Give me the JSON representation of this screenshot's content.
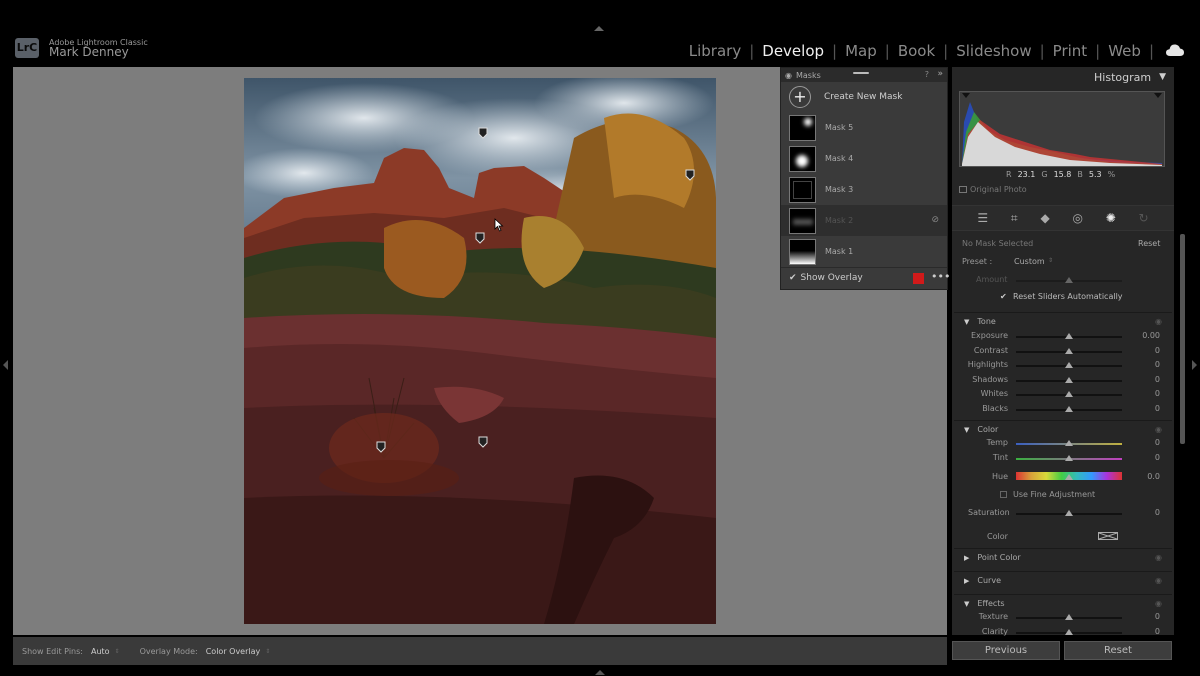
{
  "app": {
    "logo": "LrC",
    "product": "Adobe Lightroom Classic",
    "user": "Mark Denney"
  },
  "modules": [
    "Library",
    "Develop",
    "Map",
    "Book",
    "Slideshow",
    "Print",
    "Web"
  ],
  "active_module": "Develop",
  "masks_panel": {
    "title": "Masks",
    "create_label": "Create New Mask",
    "items": [
      "Mask 5",
      "Mask 4",
      "Mask 3",
      "Mask 2",
      "Mask 1"
    ],
    "selected": "Mask 2",
    "show_overlay": "Show Overlay",
    "overlay_color": "#d11a1a"
  },
  "histogram": {
    "title": "Histogram",
    "r_label": "R",
    "r": "23.1",
    "g_label": "G",
    "g": "15.8",
    "b_label": "B",
    "b": "5.3",
    "pct": "%",
    "original_photo": "Original Photo"
  },
  "adjust": {
    "no_mask": "No Mask Selected",
    "reset": "Reset",
    "preset_label": "Preset :",
    "preset_value": "Custom",
    "amount": "Amount",
    "reset_auto": "Reset Sliders Automatically",
    "tone_title": "Tone",
    "tone": [
      {
        "label": "Exposure",
        "value": "0.00",
        "pos": 0.5
      },
      {
        "label": "Contrast",
        "value": "0",
        "pos": 0.5
      },
      {
        "label": "Highlights",
        "value": "0",
        "pos": 0.5
      },
      {
        "label": "Shadows",
        "value": "0",
        "pos": 0.5
      },
      {
        "label": "Whites",
        "value": "0",
        "pos": 0.5
      },
      {
        "label": "Blacks",
        "value": "0",
        "pos": 0.5
      }
    ],
    "color_title": "Color",
    "color": [
      {
        "label": "Temp",
        "value": "0",
        "pos": 0.5
      },
      {
        "label": "Tint",
        "value": "0",
        "pos": 0.5
      }
    ],
    "hue_label": "Hue",
    "hue_value": "0.0",
    "fine_adjust": "Use Fine Adjustment",
    "saturation_label": "Saturation",
    "saturation_value": "0",
    "color_label": "Color",
    "point_color": "Point Color",
    "curve": "Curve",
    "effects_title": "Effects",
    "effects": [
      {
        "label": "Texture",
        "value": "0",
        "pos": 0.5
      },
      {
        "label": "Clarity",
        "value": "0",
        "pos": 0.5
      }
    ]
  },
  "buttons": {
    "previous": "Previous",
    "reset": "Reset"
  },
  "toolbar": {
    "edit_pins_label": "Show Edit Pins:",
    "edit_pins_value": "Auto",
    "overlay_mode_label": "Overlay Mode:",
    "overlay_mode_value": "Color Overlay"
  }
}
